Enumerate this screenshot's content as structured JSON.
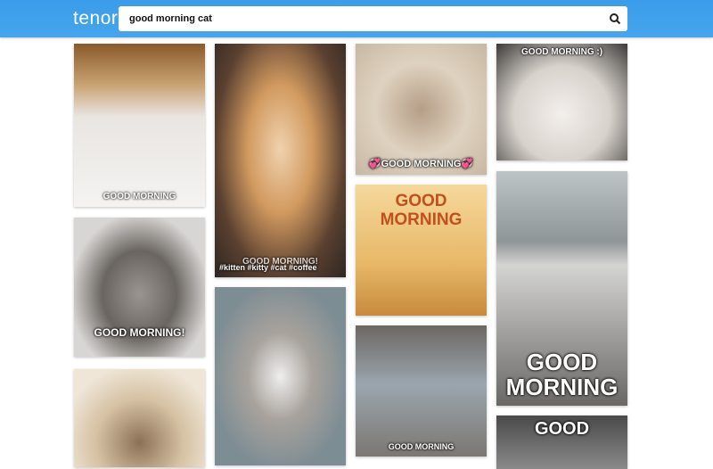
{
  "header": {
    "logo": "tenor",
    "search_value": "good morning cat",
    "search_icon": "search-icon",
    "brand_color": "#3da0ec"
  },
  "results": [
    {
      "caption": "GOOD MORNING"
    },
    {
      "caption": "GOOD MORNING!"
    },
    {
      "caption": ""
    },
    {
      "caption": "GOOD MORNING!",
      "tags": "#kitten  #kitty  #cat  #coffee"
    },
    {
      "caption": ""
    },
    {
      "caption": "💞GOOD MORNING💞"
    },
    {
      "caption": "GOOD MORNING"
    },
    {
      "caption": "GOOD MORNING"
    },
    {
      "caption": "GOOD MORNING :)"
    },
    {
      "caption": "GOOD MORNING"
    },
    {
      "caption": "GOOD"
    }
  ]
}
